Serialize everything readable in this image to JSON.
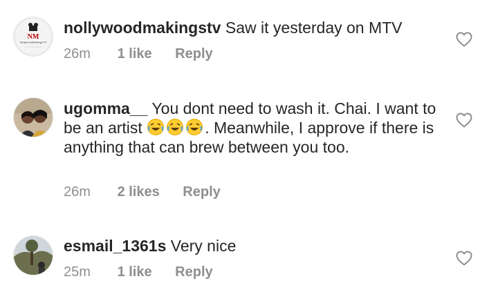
{
  "comments": [
    {
      "username": "nollywoodmakingstv",
      "text": "Saw it yesterday on MTV",
      "time": "26m",
      "likes": "1 like",
      "reply": "Reply",
      "avatar_logo_text": "NollywoodMakingsTV"
    },
    {
      "username": "ugomma__",
      "text_before_emoji": "You dont need to wash it. Chai. I want to be an artist",
      "text_after_emoji": ". Meanwhile, I approve if there is anything that can brew between you too.",
      "emoji_icon": "rolling-on-floor-laughing-emoji",
      "time": "26m",
      "likes": "2 likes",
      "reply": "Reply"
    },
    {
      "username": "esmail_1361s",
      "text": "Very nice",
      "time": "25m",
      "likes": "1 like",
      "reply": "Reply"
    }
  ],
  "icons": {
    "like": "heart-outline-icon"
  },
  "colors": {
    "text": "#262626",
    "meta": "#8e8e8e",
    "heart": "#8e8e8e"
  }
}
